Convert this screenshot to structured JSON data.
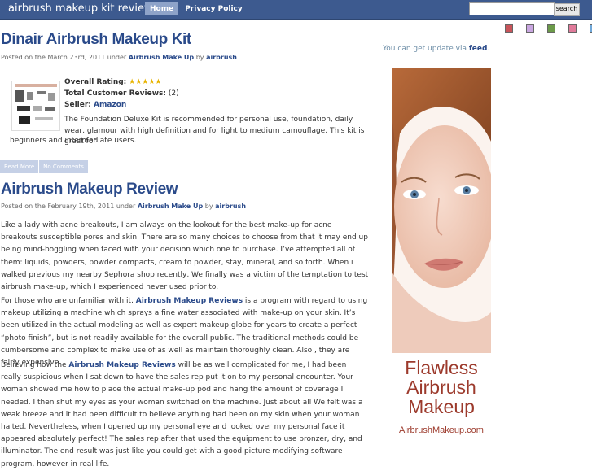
{
  "header": {
    "site_title": "airbrush makeup kit review",
    "nav": [
      "Home",
      "Privacy Policy"
    ],
    "search_placeholder": "",
    "search_button": "search"
  },
  "swatch_colors": [
    "#c8545a",
    "#c9a6e0",
    "#6c9a4a",
    "#e07a9a",
    "#6fa7d8"
  ],
  "post1": {
    "title": "Dinair Airbrush Makeup Kit",
    "meta_prefix": "Posted on the March 23rd, 2011 under ",
    "meta_category": "Airbrush Make Up",
    "meta_by": " by ",
    "meta_author": "airbrush",
    "overall_rating_label": "Overall Rating:",
    "stars": "★★★★★",
    "reviews_label": "Total Customer Reviews:",
    "reviews_value": " (2)",
    "seller_label": "Seller:",
    "seller_value": " Amazon",
    "description_a": "The Foundation Deluxe Kit is recommended for personal use, foundation, daily wear, glamour with high definition and for light to medium camouflage. This kit is great for",
    "description_b": "beginners and intermediate users.",
    "read_more": "Read More",
    "no_comments": "No Comments"
  },
  "post2": {
    "title": "Airbrush Makeup Review",
    "meta_prefix": "Posted on the February 19th, 2011 under ",
    "meta_category": "Airbrush Make Up",
    "meta_by": " by ",
    "meta_author": "airbrush",
    "para1": "Like a lady with acne breakouts, I am always on the lookout for the best make-up for acne breakouts susceptible pores and skin. There are so many choices to choose from that it may end up being mind-boggling when faced with your decision which one to purchase. I’ve attempted all of them: liquids, powders, powder compacts, cream to powder, stay, mineral, and so forth. When i walked previous my nearby Sephora shop recently, We finally was a victim of the temptation to test airbrush make-up, which I experienced never used prior to.",
    "para2_a": "For those who are unfamiliar with it, ",
    "para2_link": "Airbrush Makeup Reviews",
    "para2_b": " is a program with regard to using makeup utilizing a machine which sprays a fine water associated with make-up on your skin. It’s been utilized in the actual modeling as well as expert makeup globe for years to create a perfect “photo finish”, but is not readily available for the overall public. The traditional methods could be cumbersome and complex to make use of as well as maintain thoroughly clean. Also , they are fairly expensive.",
    "para3_a": "Believing how the ",
    "para3_link": "Airbrush Makeup Reviews",
    "para3_b": " will be as well complicated for me, I had been really suspicious when I sat down to have the sales rep put it on to my personal encounter. Your woman showed me how to place the actual make-up pod and hang the amount of coverage I needed. I then shut my eyes as your woman switched on the machine. Just about all We felt was a weak breeze and it had been difficult to believe anything had been on my skin when your woman halted. Nevertheless, when I opened up my personal eye and looked over my personal face it appeared absolutely perfect! The sales rep after that used the equipment to use bronzer, dry, and illuminator. The end result was just like you could get with a good picture modifying software program, however in real life."
  },
  "sidebar": {
    "update_text": "You can get update via ",
    "update_link": "feed",
    "update_end": ".",
    "ad_line1": "Flawless",
    "ad_line2": "Airbrush",
    "ad_line3": "Makeup",
    "ad_url": "AirbrushMakeup.com"
  }
}
